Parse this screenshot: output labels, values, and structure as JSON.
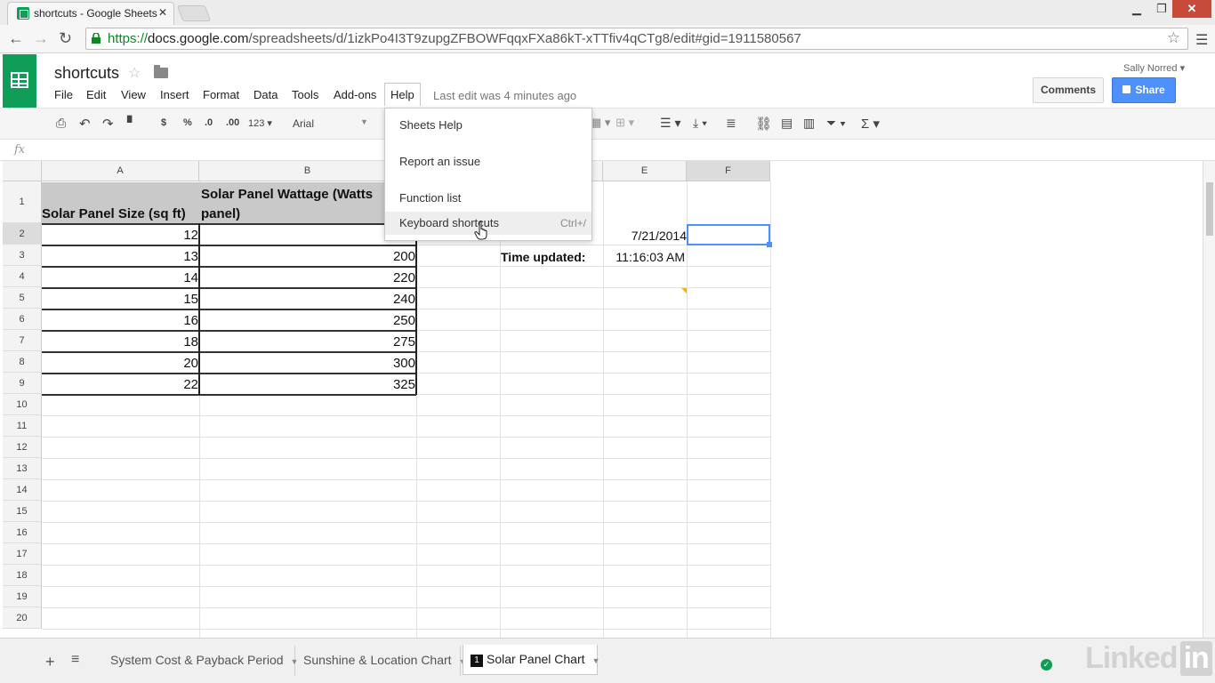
{
  "browser": {
    "tab_title": "shortcuts - Google Sheets",
    "url_scheme": "https",
    "url_host": "docs.google.com",
    "url_path": "/spreadsheets/d/1izkPo4I3T9zupgZFBOWFqqxFXa86kT-xTTfiv4qCTg8/edit#gid=1911580567"
  },
  "header": {
    "doc_title": "shortcuts",
    "last_edit": "Last edit was 4 minutes ago",
    "user_name": "Sally Norred",
    "comments_label": "Comments",
    "share_label": "Share",
    "menu": [
      "File",
      "Edit",
      "View",
      "Insert",
      "Format",
      "Data",
      "Tools",
      "Add-ons",
      "Help"
    ]
  },
  "toolbar": {
    "currency": "$",
    "percent": "%",
    "dec_less": ".0",
    "dec_more": ".00",
    "more_formats": "123",
    "font": "Arial"
  },
  "help_menu": {
    "items": [
      {
        "label": "Sheets Help",
        "shortcut": ""
      },
      {
        "label": "Report an issue",
        "shortcut": ""
      },
      {
        "label": "Function list",
        "shortcut": ""
      },
      {
        "label": "Keyboard shortcuts",
        "shortcut": "Ctrl+/"
      }
    ]
  },
  "grid": {
    "columns": [
      "A",
      "B",
      "C",
      "D",
      "E",
      "F"
    ],
    "rows": [
      "1",
      "2",
      "3",
      "4",
      "5",
      "6",
      "7",
      "8",
      "9",
      "10",
      "11",
      "12",
      "13",
      "14",
      "15",
      "16",
      "17",
      "18",
      "19",
      "20"
    ],
    "header_a": "Solar Panel Size   (sq ft)",
    "header_b_line1": "Solar Panel Wattage  (Watts",
    "header_b_line2": "panel)",
    "sizes": [
      "12",
      "13",
      "14",
      "15",
      "16",
      "18",
      "20",
      "22"
    ],
    "wattages": [
      "",
      "200",
      "220",
      "240",
      "250",
      "275",
      "300",
      "325"
    ],
    "date_value": "7/21/2014",
    "time_label": "Time updated:",
    "time_value": "11:16:03 AM",
    "fx": "fx"
  },
  "sheets": {
    "tabs": [
      {
        "label": "System Cost & Payback Period"
      },
      {
        "label": "Sunshine & Location Chart"
      },
      {
        "label": "Solar Panel Chart",
        "badge": "1"
      }
    ]
  },
  "watermark": "LinkedIn"
}
